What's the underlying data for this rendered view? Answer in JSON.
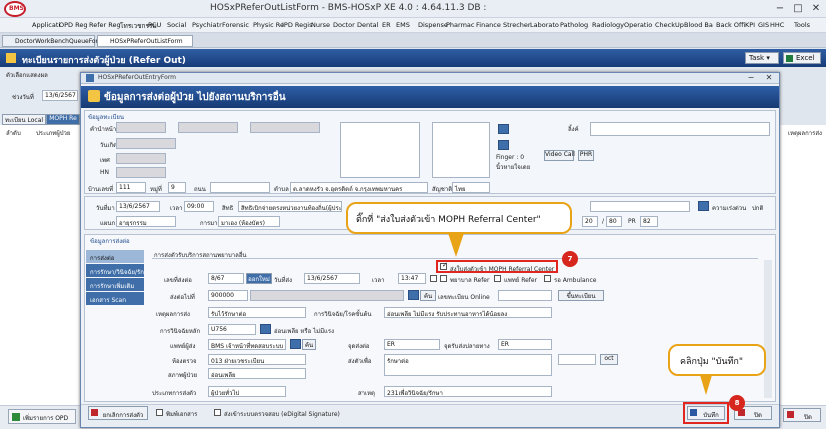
{
  "app": {
    "title": "HOSxPReferOutListForm - BMS-HOSxP XE 4.0 : 4.64.11.3 DB :",
    "logo": "BMS",
    "minimize": "−",
    "maximize": "□",
    "close": "✕"
  },
  "menu": [
    "Applicati",
    "OPD Reg",
    "Refer Reg",
    "โทรเวชกรรม",
    "PCU",
    "Social",
    "Psychiatr",
    "Forensic",
    "Physic Re",
    "IPD Regis",
    "Nurse",
    "Doctor",
    "Dental",
    "ER",
    "EMS",
    "Dispense",
    "Pharmac",
    "Finance",
    "Strecher",
    "Laborato",
    "Patholog",
    "Radiology",
    "Operatio",
    "CheckUp",
    "Blood Ba",
    "Back Offi",
    "KPI",
    "GIS",
    "HHC",
    "Tools"
  ],
  "tabs": [
    {
      "label": "DoctorWorkBenchQueueForm"
    },
    {
      "label": "HOSxPReferOutListForm"
    }
  ],
  "main": {
    "title": "ทะเบียนรายการส่งตัวผู้ป่วย (Refer Out)",
    "task_label": "Task",
    "excel_label": "Excel",
    "left": {
      "group_label": "ตัวเลือกแสดงผล",
      "date_label": "ช่วงวันที่",
      "date_value": "13/6/2567",
      "tab_local": "ทะเบียน Local",
      "tab_moph": "MOPH Re",
      "col1": "ลำดับ",
      "col2": "ประเภทผู้ป่วย",
      "right_col": "เหตุผลการส่ง"
    },
    "add_opd_label": "เพิ่มรายการ OPD"
  },
  "dialog": {
    "window_title": "HOSxPReferOutEntryForm",
    "header": "ข้อมูลการส่งต่อผู้ป่วย ไปยังสถานบริการอื่น",
    "patient": {
      "group_label": "ข้อมูลทะเบียน",
      "fields": [
        "คำนำหน้า",
        "วันเกิด",
        "เพศ",
        "HN"
      ],
      "photo_label": "ลิ้งค์",
      "house_no_label": "บ้านเลขที่",
      "house_no": "111",
      "moo_label": "หมู่ที่",
      "moo": "9",
      "road_label": "ถนน",
      "tambon_label": "ตำบล",
      "tambon_value": "ต.ลาดหงรัว จ.อุตรดิตถ์ จ.กรุงเทพมหานคร",
      "nation_label": "สัญชาติ",
      "nation_value": "ไทย",
      "finger_label": "Finger : 0",
      "finger_status": "นิ้วหายใจเดย",
      "video_call": "Video Call",
      "phr": "PHR"
    },
    "visit": {
      "date_label": "วันที่มา",
      "date_value": "13/6/2567",
      "time_label": "เวลา",
      "time_value": "09:00",
      "right_label": "สิทธิ",
      "right_value": "สิทธิเบิกจ่ายตรงหน่วยงานท้องถิ่น(ผู้ประกันตน)",
      "dept_label": "แผนก",
      "dept_value": "อายุรกรรม",
      "room_label": "การมา",
      "room_value": "มาเอง (ห้องบัตร)",
      "urgent_label": "ความเร่งด่วน",
      "urgent_value": "ปกติ",
      "bp1": "20",
      "bp2": "80",
      "pr_label": "PR",
      "pr_value": "82"
    },
    "refer_group_label": "ข้อมูลการส่งต่อ",
    "nav": [
      "การส่งต่อ",
      "การรักษา/วินิจฉัย/รักษา",
      "การรักษาเพิ่มเติม",
      "เอกสาร Scan"
    ],
    "form": {
      "title": "การส่งตัวรับบริการสถานพยาบาลอื่น",
      "refno_label": "เลขที่ส่งต่อ",
      "refno": "8/67",
      "new_no_btn": "ออกใหม่",
      "refer_date_label": "วันที่ส่ง",
      "refer_date": "13/6/2567",
      "refer_time_label": "เวลา",
      "refer_time": "13:47",
      "moph_cb_label": "ส่งใบส่งตัวเข้า MOPH Referral Center",
      "nurse_label": "พยาบาล Refer",
      "doctor_refer_label": "แพทย์ Refer",
      "ambulance_label": "รอ Ambulance",
      "dest_label": "ส่งต่อไปที่",
      "dest_code": "900000",
      "find_btn": "ค้น",
      "online_label": "เลขทะเบียน Online",
      "register_btn": "ขึ้นทะเบียน",
      "cause_label": "เหตุผลการส่ง",
      "cause_value": "รับไว้รักษาต่อ",
      "dx_note_label": "การวินิจฉัย/โรคขั้นต้น",
      "dx_note_value": "อ่อนเพลีย ไม่มีแรง รับประทานอาหารได้น้อยลง",
      "main_dx_label": "การวินิจฉัยหลัก",
      "main_dx_code": "U756",
      "main_dx_text": "อ่อนเพลีย หรือ ไม่มีแรง",
      "doctor_label": "แพทย์ผู้ส่ง",
      "doctor_value": "BMS เจ้าหน้าที่ทดสอบระบบ",
      "point_label": "จุดส่งต่อ",
      "point_value": "ER",
      "dest_point_label": "จุดรับส่งปลายทาง",
      "dest_point_value": "ER",
      "room_label": "ห้องตรวจ",
      "room_value": "013 ฝ่ายเวชระเบียน",
      "purpose_label": "ส่งตัวเพื่อ",
      "purpose_value": "รักษาต่อ",
      "oct_btn": "oct",
      "status_label": "สภาพผู้ป่วย",
      "status_value": "อ่อนเพลีย",
      "type_label": "ประเภทการส่งตัว",
      "type_value": "ผู้ป่วยทั่วไป",
      "reason_label": "สาเหตุ",
      "reason_value": "231เพื่อวินิจฉัย/รักษา"
    },
    "footer": {
      "cancel_label": "ยกเลิกการส่งตัว",
      "print_label": "พิมพ์เอกสาร",
      "esign_label": "ส่งเข้าระบบตรวจสอบ (eDigital Signature)",
      "save_label": "บันทึก",
      "close_label": "ปิด"
    }
  },
  "annotations": {
    "callout7": "ติ๊กที่ \"ส่งใบส่งตัวเข้า MOPH Referral Center\"",
    "badge7": "7",
    "callout8": "คลิกปุ่ม \"บันทึก\"",
    "badge8": "8"
  },
  "colors": {
    "header": "#1f4a8c",
    "annotation_border": "#e9a317",
    "highlight": "#e0261f"
  }
}
